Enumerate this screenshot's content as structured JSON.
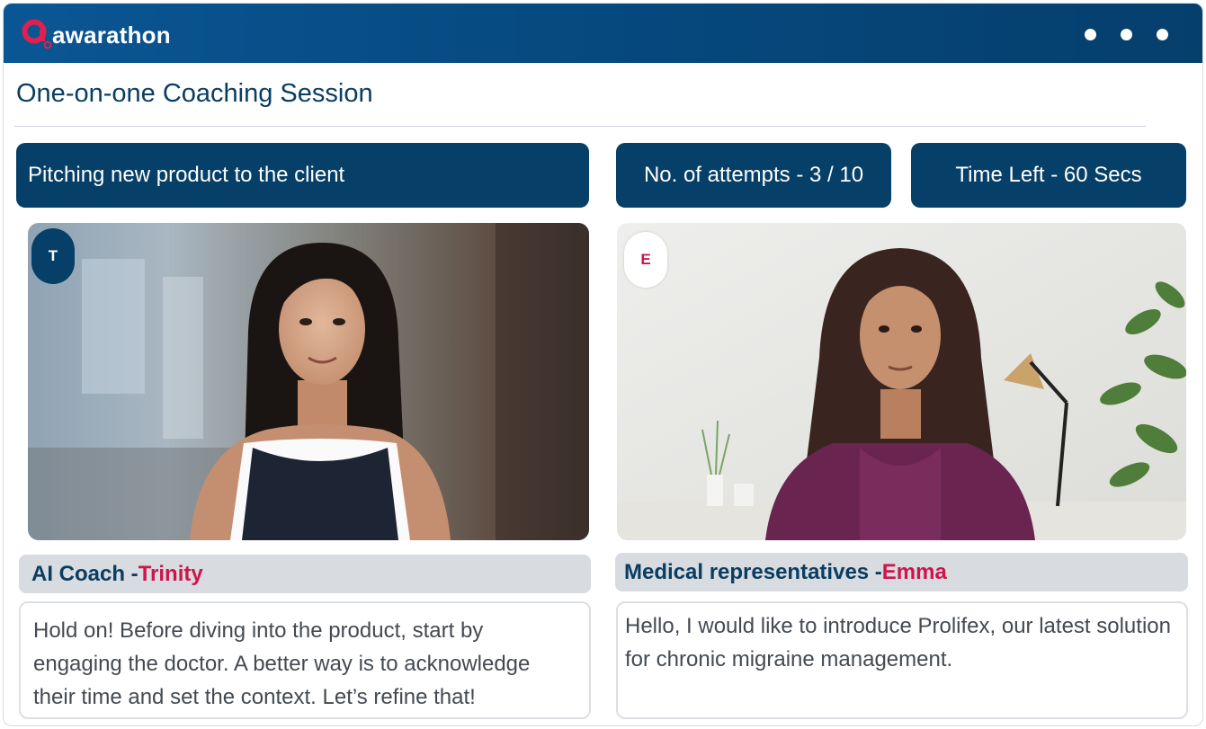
{
  "app": {
    "brand": "awarathon",
    "colors": {
      "primary": "#063f67",
      "accent": "#d0144a",
      "topbar": "#0a5694"
    }
  },
  "window_controls": [
    "dot-icon",
    "dot-icon",
    "dot-icon"
  ],
  "page": {
    "title": "One-on-one Coaching Session"
  },
  "status": {
    "task": "Pitching new product to the client",
    "attempts": "No. of attempts - 3 / 10",
    "time_left": "Time Left - 60 Secs"
  },
  "coach": {
    "initial": "T",
    "role": "AI Coach - ",
    "name": "Trinity",
    "message": "Hold on! Before diving into the product, start by engaging the doctor. A better way is to acknowledge their time and set the context. Let’s refine that!"
  },
  "user": {
    "initial": "E",
    "role": "Medical representatives - ",
    "name": "Emma",
    "message": "Hello, I would like to introduce Prolifex, our latest solution for chronic migraine management."
  }
}
